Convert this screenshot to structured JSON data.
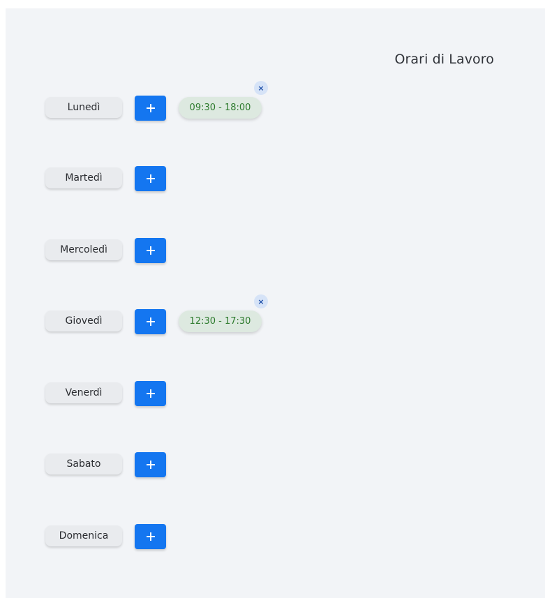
{
  "header": {
    "title": "Orari di Lavoro"
  },
  "days": [
    {
      "label": "Lunedì",
      "slots": [
        "09:30 - 18:00"
      ]
    },
    {
      "label": "Martedì",
      "slots": []
    },
    {
      "label": "Mercoledì",
      "slots": []
    },
    {
      "label": "Giovedì",
      "slots": [
        "12:30 - 17:30"
      ]
    },
    {
      "label": "Venerdì",
      "slots": []
    },
    {
      "label": "Sabato",
      "slots": []
    },
    {
      "label": "Domenica",
      "slots": []
    }
  ],
  "icons": {
    "add": "plus-icon",
    "remove": "close-icon"
  },
  "glyphs": {
    "remove": "×"
  },
  "colors": {
    "accent": "#1476f0",
    "slot_bg": "#dde9e0",
    "slot_text": "#2c7a2c",
    "panel_bg": "#f2f4f7"
  }
}
